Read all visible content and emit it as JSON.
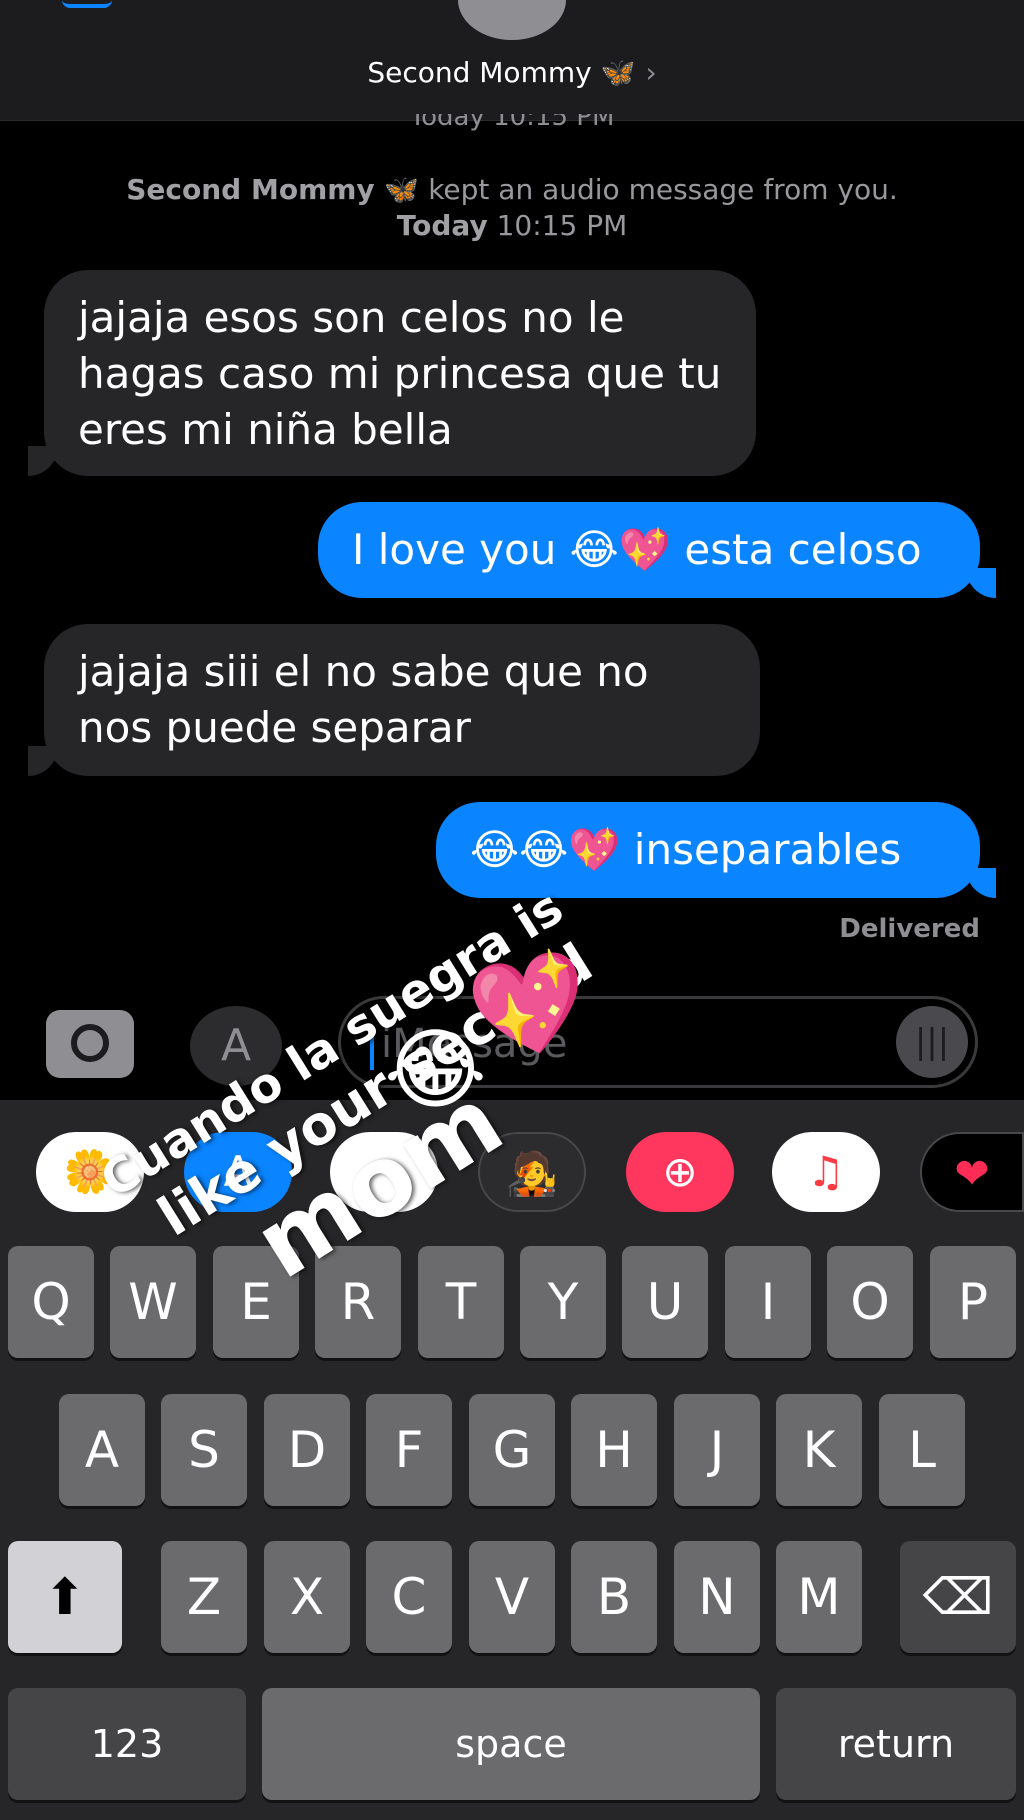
{
  "header": {
    "contact_name": "Second Mommy 🦋",
    "chevron": "›",
    "cut_timestamp": "Today 10:15 PM"
  },
  "system_note": {
    "name": "Second Mommy 🦋",
    "text": "kept an audio message from you.",
    "day": "Today",
    "time": "10:15 PM"
  },
  "messages": [
    {
      "direction": "incoming",
      "text": "jajaja esos son celos no le hagas caso mi princesa que tu eres mi niña bella"
    },
    {
      "direction": "outgoing",
      "text": "I love you 😂💖 esta celoso"
    },
    {
      "direction": "incoming",
      "text": "jajaja siii el no sabe que no nos puede separar"
    },
    {
      "direction": "outgoing",
      "text": "😂😂💖 inseparables"
    }
  ],
  "delivered_label": "Delivered",
  "input": {
    "placeholder": "iMessage",
    "apps_glyph": "A",
    "audio_glyph": "|||"
  },
  "app_strip": {
    "photos": "🌼",
    "store": "A",
    "animoji": "🐵",
    "memoji": "🧑‍🎤",
    "search": "⊕",
    "music": "♫",
    "fitness": "❤"
  },
  "keyboard": {
    "row1": [
      "Q",
      "W",
      "E",
      "R",
      "T",
      "Y",
      "U",
      "I",
      "O",
      "P"
    ],
    "row2": [
      "A",
      "S",
      "D",
      "F",
      "G",
      "H",
      "J",
      "K",
      "L"
    ],
    "row3": [
      "Z",
      "X",
      "C",
      "V",
      "B",
      "N",
      "M"
    ],
    "shift": "⬆",
    "delete": "⌫",
    "numbers": "123",
    "space": "space",
    "return": "return"
  },
  "overlay": {
    "line1": "Cuando la suegra is",
    "line2": "like your second",
    "line3": "mom",
    "heart": "💖",
    "laugh": "😂"
  },
  "colors": {
    "outgoing_bubble": "#0a84ff",
    "incoming_bubble": "#262629",
    "background": "#000000"
  }
}
